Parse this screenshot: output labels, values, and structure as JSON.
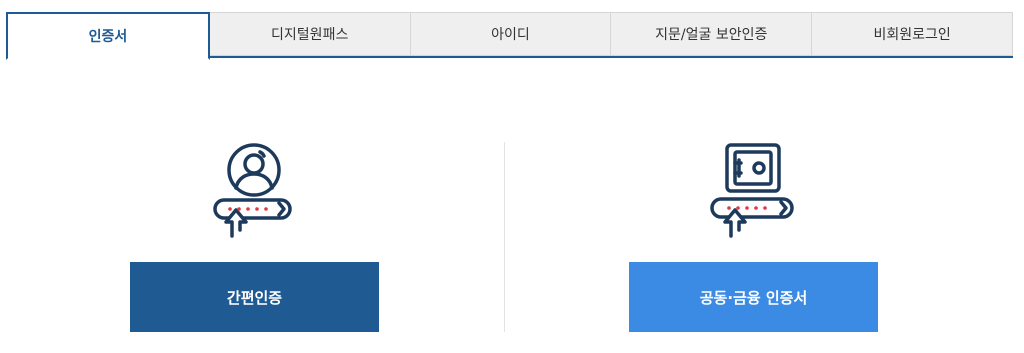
{
  "tabs": [
    {
      "label": "인증서",
      "active": true
    },
    {
      "label": "디지털원패스",
      "active": false
    },
    {
      "label": "아이디",
      "active": false
    },
    {
      "label": "지문/얼굴 보안인증",
      "active": false
    },
    {
      "label": "비회원로그인",
      "active": false
    }
  ],
  "login_options": {
    "simple": {
      "icon": "person-password-icon",
      "label": "간편인증"
    },
    "joint": {
      "icon": "safe-password-icon",
      "label": "공동·금융 인증서"
    }
  },
  "colors": {
    "primary": "#1e5a93",
    "accent": "#3b8ae4",
    "icon_stroke": "#1d3a5c",
    "password_dots": "#e0393e"
  }
}
